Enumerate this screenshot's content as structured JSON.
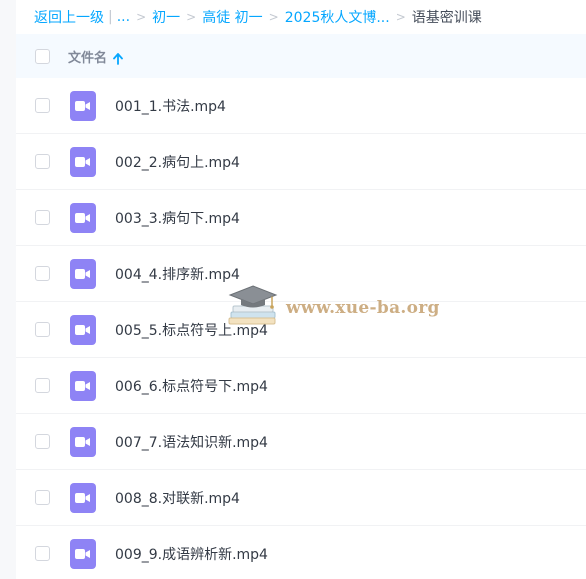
{
  "breadcrumb": {
    "back": "返回上一级",
    "ellipsis": "...",
    "items": [
      "初一",
      "高徒 初一",
      "2025秋人文博..."
    ],
    "current": "语基密训课",
    "separator": ">",
    "divider": "|"
  },
  "list_header": {
    "column_name": "文件名",
    "sort": "ascending"
  },
  "files": [
    {
      "name": "001_1.书法.mp4",
      "type": "video"
    },
    {
      "name": "002_2.病句上.mp4",
      "type": "video"
    },
    {
      "name": "003_3.病句下.mp4",
      "type": "video"
    },
    {
      "name": "004_4.排序新.mp4",
      "type": "video"
    },
    {
      "name": "005_5.标点符号上.mp4",
      "type": "video"
    },
    {
      "name": "006_6.标点符号下.mp4",
      "type": "video"
    },
    {
      "name": "007_7.语法知识新.mp4",
      "type": "video"
    },
    {
      "name": "008_8.对联新.mp4",
      "type": "video"
    },
    {
      "name": "009_9.成语辨析新.mp4",
      "type": "video"
    }
  ],
  "watermark": {
    "text": "www.xue-ba.org",
    "icon": "graduation-cap-icon"
  },
  "colors": {
    "accent": "#06a7ff",
    "video_icon": "#8e83f5",
    "header_bg": "#f5faff",
    "text": "#333a45"
  }
}
